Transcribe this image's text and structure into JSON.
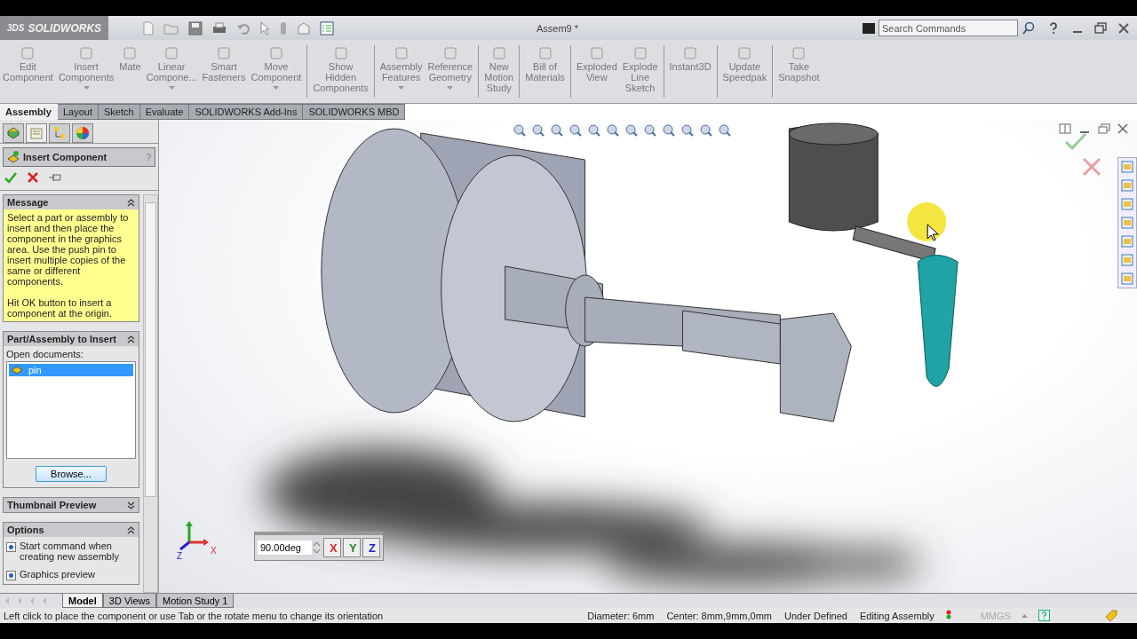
{
  "app": {
    "logo_mark": "3DS",
    "logo": "SOLIDWORKS"
  },
  "window": {
    "title": "Assem9 *"
  },
  "search": {
    "placeholder": "Search Commands"
  },
  "ribbon": {
    "groups": [
      [
        {
          "label": "Edit\nComponent",
          "dropdown": false
        },
        {
          "label": "Insert\nComponents",
          "dropdown": true
        },
        {
          "label": "Mate",
          "dropdown": false
        },
        {
          "label": "Linear\nCompone...",
          "dropdown": true
        },
        {
          "label": "Smart\nFasteners",
          "dropdown": false
        },
        {
          "label": "Move\nComponent",
          "dropdown": true
        }
      ],
      [
        {
          "label": "Show\nHidden\nComponents",
          "dropdown": false
        }
      ],
      [
        {
          "label": "Assembly\nFeatures",
          "dropdown": true
        },
        {
          "label": "Reference\nGeometry",
          "dropdown": true
        }
      ],
      [
        {
          "label": "New\nMotion\nStudy",
          "dropdown": false
        }
      ],
      [
        {
          "label": "Bill of\nMaterials",
          "dropdown": false
        }
      ],
      [
        {
          "label": "Exploded\nView",
          "dropdown": false
        },
        {
          "label": "Explode\nLine\nSketch",
          "dropdown": false
        }
      ],
      [
        {
          "label": "Instant3D",
          "dropdown": false
        }
      ],
      [
        {
          "label": "Update\nSpeedpak",
          "dropdown": false
        }
      ],
      [
        {
          "label": "Take\nSnapshot",
          "dropdown": false
        }
      ]
    ]
  },
  "tabs": [
    {
      "label": "Assembly",
      "selected": true
    },
    {
      "label": "Layout",
      "selected": false
    },
    {
      "label": "Sketch",
      "selected": false
    },
    {
      "label": "Evaluate",
      "selected": false
    },
    {
      "label": "SOLIDWORKS Add-Ins",
      "selected": false
    },
    {
      "label": "SOLIDWORKS MBD",
      "selected": false
    }
  ],
  "property_manager": {
    "title": "Insert Component",
    "help": "?",
    "sections": [
      {
        "kind": "message",
        "title": "Message",
        "expanded": true,
        "text": "Select a part or assembly to insert and then place the component in the graphics area. Use the push pin to insert multiple copies of the same or different components.\n\nHit OK button to insert a component at the origin."
      },
      {
        "kind": "documents",
        "title": "Part/Assembly to Insert",
        "expanded": true,
        "label": "Open documents:",
        "items": [
          {
            "name": "pin",
            "selected": true
          }
        ],
        "button": "Browse..."
      },
      {
        "kind": "empty",
        "title": "Thumbnail Preview",
        "expanded": false
      },
      {
        "kind": "options",
        "title": "Options",
        "expanded": true,
        "options": [
          {
            "label": "Start command when creating new assembly",
            "checked": true
          },
          {
            "label": "Graphics preview",
            "checked": true
          }
        ]
      }
    ]
  },
  "rotate_popup": {
    "value": "90.00deg",
    "axes": [
      "X",
      "Y",
      "Z"
    ]
  },
  "triad": {
    "labels": [
      "X",
      "Z"
    ]
  },
  "bottom_tabs": [
    {
      "label": "Model",
      "selected": true
    },
    {
      "label": "3D Views",
      "selected": false
    },
    {
      "label": "Motion Study 1",
      "selected": false
    }
  ],
  "status_bar": {
    "message": "Left click to place the component or use Tab or the rotate menu to change its orientation",
    "fields": [
      "Diameter: 6mm",
      "Center: 8mm,9mm,0mm",
      "Under Defined",
      "Editing Assembly"
    ],
    "units": "MMGS"
  }
}
